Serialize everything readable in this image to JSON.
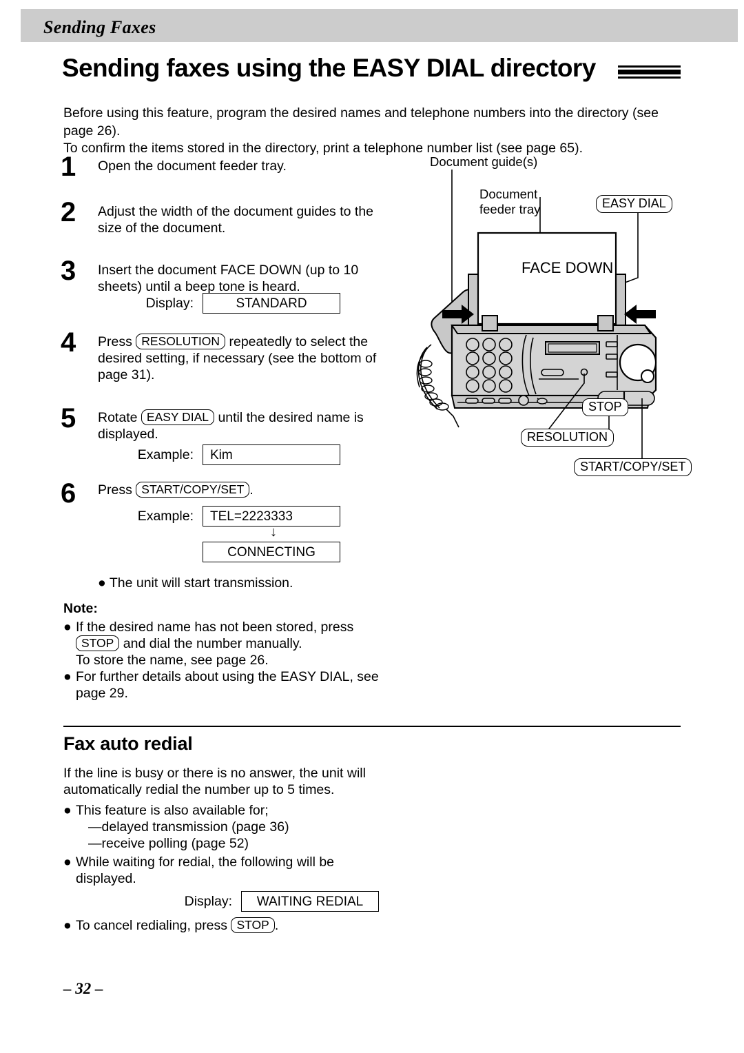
{
  "header": {
    "section_label": "Sending Faxes",
    "title": "Sending faxes using the EASY DIAL directory"
  },
  "intro": {
    "line1": "Before using this feature, program the desired names and telephone numbers into the directory (see page 26).",
    "line2": "To confirm the items stored in the directory, print a telephone number list (see page 65)."
  },
  "steps": [
    {
      "num": "1",
      "text": "Open the document feeder tray."
    },
    {
      "num": "2",
      "text": "Adjust the width of the document guides to the size of the document."
    },
    {
      "num": "3",
      "text_before": "Insert the document FACE DOWN (up to 10 sheets) until a beep tone is heard.",
      "display_label": "Display:",
      "display_value": "STANDARD"
    },
    {
      "num": "4",
      "text_a": "Press",
      "key": "RESOLUTION",
      "text_b": "repeatedly to select the desired setting, if necessary (see the bottom of page 31)."
    },
    {
      "num": "5",
      "text_a": "Rotate",
      "key": "EASY DIAL",
      "text_b": "until the desired name is displayed.",
      "display_label": "Example:",
      "display_value": "Kim"
    },
    {
      "num": "6",
      "text_a": "Press",
      "key": "START/COPY/SET",
      "text_b": ".",
      "display_label": "Example:",
      "display_value": "TEL=2223333",
      "arrow": "↓",
      "display_value2": "CONNECTING",
      "bullet": "● The unit will start transmission."
    }
  ],
  "note": {
    "heading": "Note:",
    "bullet_char": "●",
    "items": [
      {
        "part_a": "If the desired name has not been stored, press",
        "key": "STOP",
        "part_b": "and dial the number manually.",
        "part_c": "To store the name, see page 26."
      },
      {
        "part_a": "For further details about using the EASY DIAL, see page 29."
      }
    ]
  },
  "fax_auto_redial": {
    "title": "Fax auto redial",
    "paragraph": "If the line is busy or there is no answer, the unit will automatically redial the number up to 5 times.",
    "bullet_char": "●",
    "bullet1": "This feature is also available for;",
    "dash1": "—delayed transmission (page 36)",
    "dash2": "—receive polling (page 52)",
    "bullet2": "While waiting for redial, the following will be displayed.",
    "display_label": "Display:",
    "display_value": "WAITING REDIAL",
    "bullet3_a": "To cancel redialing, press",
    "bullet3_key": "STOP",
    "bullet3_b": "."
  },
  "illustration": {
    "callout_document_guides": "Document guide(s)",
    "callout_document_feeder_tray": "Document\nfeeder tray",
    "label_face_down": "FACE DOWN",
    "key_easy_dial": "EASY DIAL",
    "key_stop": "STOP",
    "key_resolution": "RESOLUTION",
    "key_start_copy_set": "START/COPY/SET"
  },
  "footer": {
    "page_number": "– 32 –"
  },
  "colors": {
    "header_bar": "#cccccc",
    "ink": "#000000",
    "paper": "#ffffff",
    "device_body": "#d4d4d4"
  }
}
